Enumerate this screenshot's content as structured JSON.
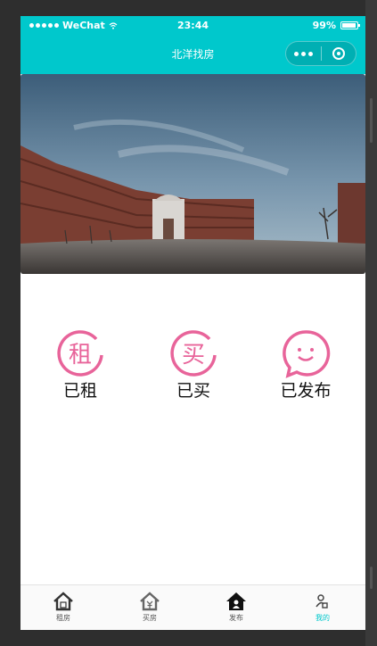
{
  "statusbar": {
    "carrier": "WeChat",
    "time": "23:44",
    "battery": "99%"
  },
  "navbar": {
    "title": "北洋找房"
  },
  "quick_actions": [
    {
      "label": "已租",
      "glyph": "租",
      "icon": "rent-icon"
    },
    {
      "label": "已买",
      "glyph": "买",
      "icon": "buy-icon"
    },
    {
      "label": "已发布",
      "icon": "smile-icon"
    }
  ],
  "tabbar": {
    "items": [
      {
        "label": "租房",
        "icon": "rent-house-icon"
      },
      {
        "label": "买房",
        "icon": "buy-house-icon"
      },
      {
        "label": "发布",
        "icon": "publish-house-icon"
      },
      {
        "label": "我的",
        "icon": "profile-icon",
        "active": true
      }
    ]
  },
  "colors": {
    "accent": "#00c8cc",
    "icon_pink": "#e8649a"
  }
}
